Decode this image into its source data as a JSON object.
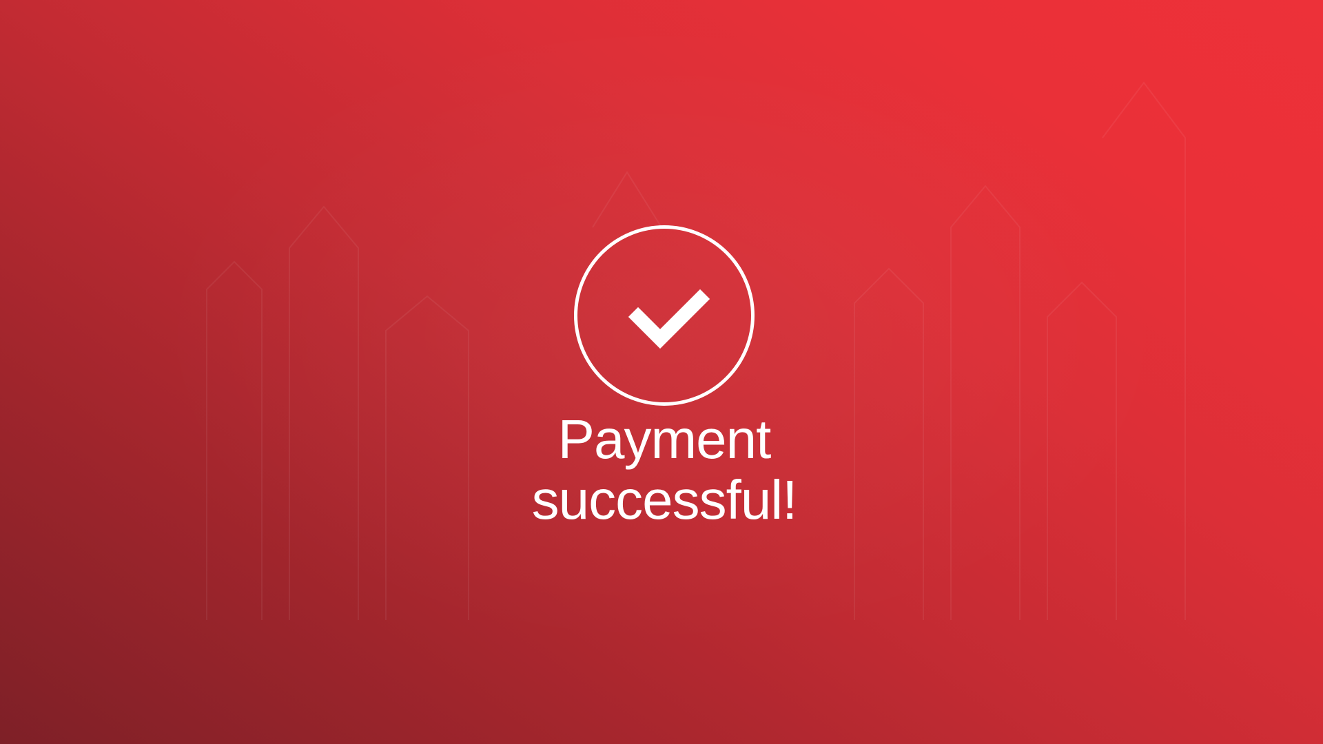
{
  "screen": {
    "background_colors": [
      "#7e2027",
      "#c32b33",
      "#ed3139"
    ],
    "foreground_color": "#ffffff"
  },
  "status": {
    "icon": "checkmark-circle-icon",
    "message_line1": "Payment",
    "message_line2": "successful!"
  }
}
